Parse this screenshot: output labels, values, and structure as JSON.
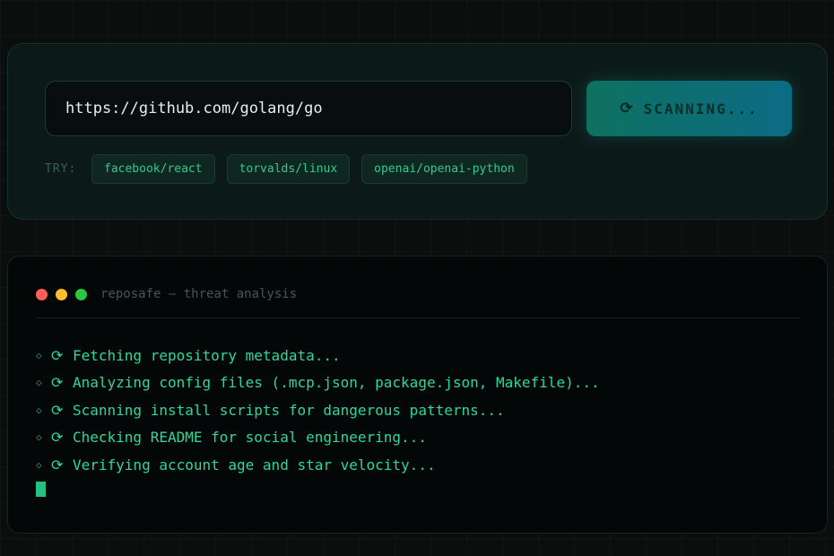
{
  "scan_panel": {
    "url_input": {
      "value": "https://github.com/golang/go",
      "placeholder": ""
    },
    "scan_button": {
      "label": "SCANNING...",
      "icon": "spinner-icon"
    },
    "try_label": "TRY:",
    "suggestions": [
      "facebook/react",
      "torvalds/linux",
      "openai/openai-python"
    ]
  },
  "terminal": {
    "title": "reposafe — threat analysis",
    "window_dots": [
      "#ff5f57",
      "#febc2e",
      "#28c840"
    ],
    "lines": [
      "Fetching repository metadata...",
      "Analyzing config files (.mcp.json, package.json, Makefile)...",
      "Scanning install scripts for dangerous patterns...",
      "Checking README for social engineering...",
      "Verifying account age and star velocity..."
    ]
  },
  "colors": {
    "accent": "#2fd79a",
    "button_gradient_start": "#0f7b68",
    "button_gradient_end": "#0b7490",
    "background": "#0a0f0e"
  }
}
